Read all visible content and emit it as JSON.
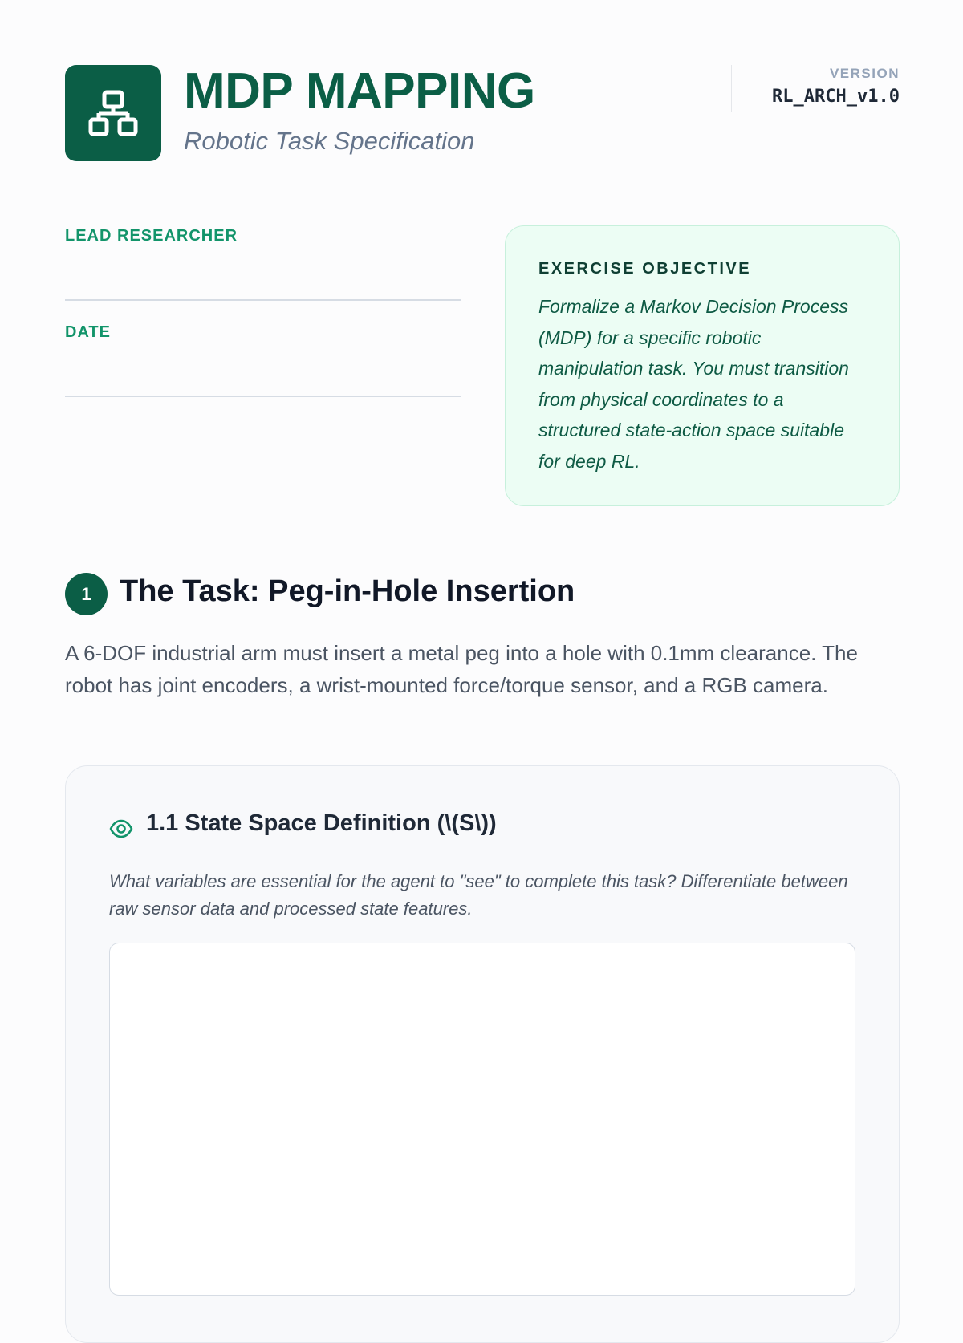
{
  "header": {
    "title": "MDP MAPPING",
    "subtitle": "Robotic Task Specification",
    "version_label": "VERSION",
    "version_value": "RL_ARCH_v1.0",
    "logo_icon": "sitemap-icon"
  },
  "fields": {
    "lead_researcher_label": "LEAD RESEARCHER",
    "date_label": "DATE"
  },
  "objective": {
    "title": "EXERCISE OBJECTIVE",
    "text": "Formalize a Markov Decision Process (MDP) for a specific robotic manipulation task. You must transition from physical coordinates to a structured state-action space suitable for deep RL."
  },
  "section1": {
    "number": "1",
    "title": "The Task: Peg-in-Hole Insertion",
    "description": "A 6-DOF industrial arm must insert a metal peg into a hole with 0.1mm clearance. The robot has joint encoders, a wrist-mounted force/torque sensor, and a RGB camera."
  },
  "subsection": {
    "icon": "eye-icon",
    "title": "1.1 State Space Definition (\\(S\\))",
    "prompt": "What variables are essential for the agent to \"see\" to complete this task? Differentiate between raw sensor data and processed state features.",
    "answer": ""
  },
  "colors": {
    "brand": "#0b5e46",
    "accent": "#12946a",
    "objective_bg": "#ecfdf4"
  }
}
